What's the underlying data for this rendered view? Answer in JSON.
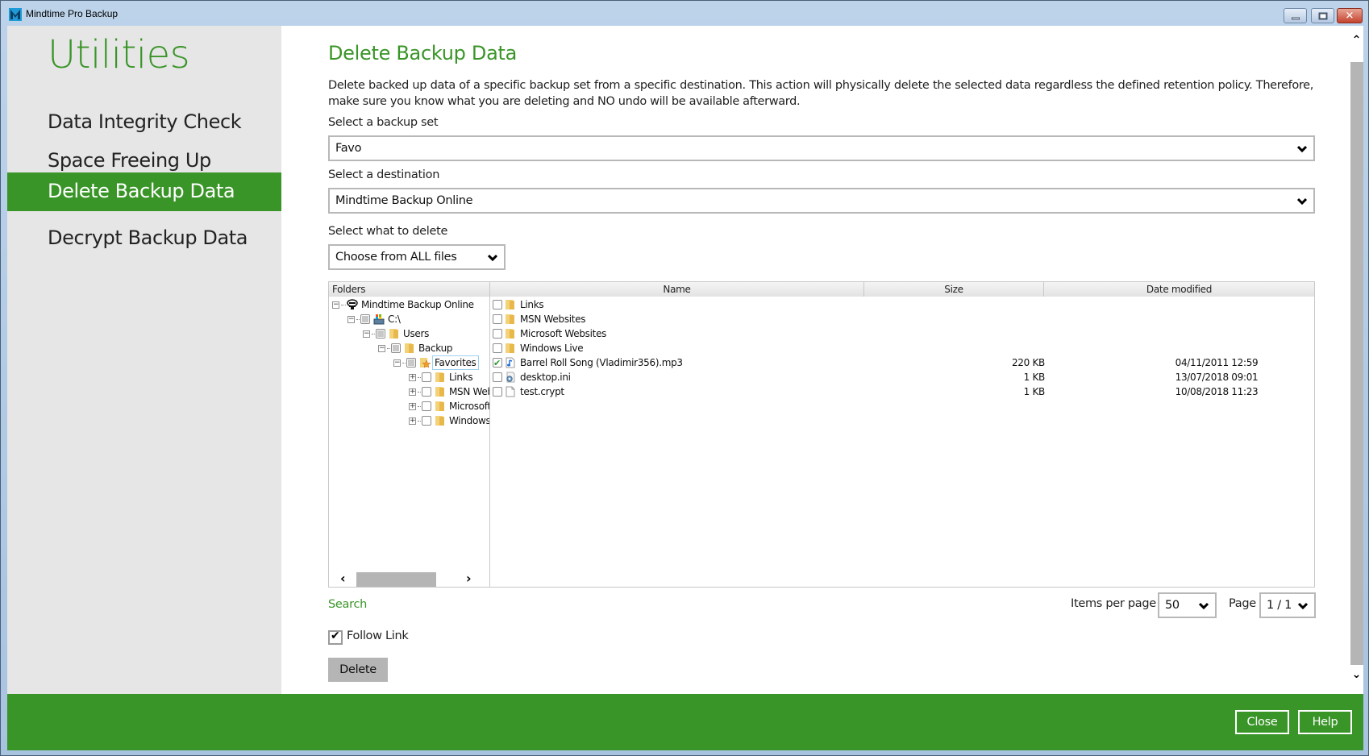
{
  "window": {
    "title": "Mindtime Pro Backup",
    "controls": {
      "minimize": "minimize",
      "maximize": "maximize",
      "close": "✕"
    }
  },
  "sidebar": {
    "title": "Utilities",
    "items": [
      {
        "label": "Data Integrity Check",
        "active": false
      },
      {
        "label": "Space Freeing Up",
        "active": false
      },
      {
        "label": "Delete Backup Data",
        "active": true
      },
      {
        "label": "Decrypt Backup Data",
        "active": false
      }
    ]
  },
  "main": {
    "title": "Delete Backup Data",
    "description": "Delete backed up data of a specific backup set from a specific destination. This action will physically delete the selected data regardless the defined retention policy. Therefore, make sure you know what you are deleting and NO undo will be available afterward.",
    "backup_set": {
      "label": "Select a backup set",
      "value": "Favo"
    },
    "destination": {
      "label": "Select a destination",
      "value": "Mindtime Backup Online"
    },
    "what_to_delete": {
      "label": "Select what to delete",
      "value": "Choose from ALL files"
    }
  },
  "browser": {
    "folders_header": "Folders",
    "tree": [
      {
        "label": "Mindtime Backup Online",
        "icon": "cloud-server-icon",
        "expander": "minus",
        "check": "none"
      },
      {
        "label": "C:\\",
        "icon": "drive-icon",
        "expander": "minus",
        "check": "partial"
      },
      {
        "label": "Users",
        "icon": "folder-icon",
        "expander": "minus",
        "check": "partial"
      },
      {
        "label": "Backup",
        "icon": "folder-icon",
        "expander": "minus",
        "check": "partial"
      },
      {
        "label": "Favorites",
        "icon": "favorites-folder-icon",
        "expander": "minus",
        "check": "partial",
        "selected": true
      },
      {
        "label": "Links",
        "icon": "folder-icon",
        "expander": "plus",
        "check": "unchecked"
      },
      {
        "label": "MSN Websites",
        "icon": "folder-icon",
        "expander": "plus",
        "check": "unchecked"
      },
      {
        "label": "Microsoft Websites",
        "icon": "folder-icon",
        "expander": "plus",
        "check": "unchecked"
      },
      {
        "label": "Windows Live",
        "icon": "folder-icon",
        "expander": "plus",
        "check": "unchecked"
      }
    ],
    "columns": {
      "name": "Name",
      "size": "Size",
      "date": "Date modified"
    },
    "files": [
      {
        "name": "Links",
        "icon": "folder-icon",
        "size": "",
        "date": "",
        "checked": false
      },
      {
        "name": "MSN Websites",
        "icon": "folder-icon",
        "size": "",
        "date": "",
        "checked": false
      },
      {
        "name": "Microsoft Websites",
        "icon": "folder-icon",
        "size": "",
        "date": "",
        "checked": false
      },
      {
        "name": "Windows Live",
        "icon": "folder-icon",
        "size": "",
        "date": "",
        "checked": false
      },
      {
        "name": "Barrel Roll Song (Vladimir356).mp3",
        "icon": "audio-file-icon",
        "size": "220 KB",
        "date": "04/11/2011 12:59",
        "checked": true
      },
      {
        "name": "desktop.ini",
        "icon": "settings-file-icon",
        "size": "1 KB",
        "date": "13/07/2018 09:01",
        "checked": false
      },
      {
        "name": "test.crypt",
        "icon": "blank-file-icon",
        "size": "1 KB",
        "date": "10/08/2018 11:23",
        "checked": false
      }
    ]
  },
  "search_label": "Search",
  "pager": {
    "items_per_page_label": "Items per page",
    "items_per_page_value": "50",
    "page_label": "Page",
    "page_value": "1 / 1"
  },
  "follow_link": {
    "label": "Follow Link",
    "checked": true
  },
  "delete_label": "Delete",
  "footer": {
    "close_label": "Close",
    "help_label": "Help"
  },
  "colors": {
    "accent": "#3a9528",
    "sidebar_bg": "#e6e6e6",
    "button_gray": "#b5b5b5"
  }
}
